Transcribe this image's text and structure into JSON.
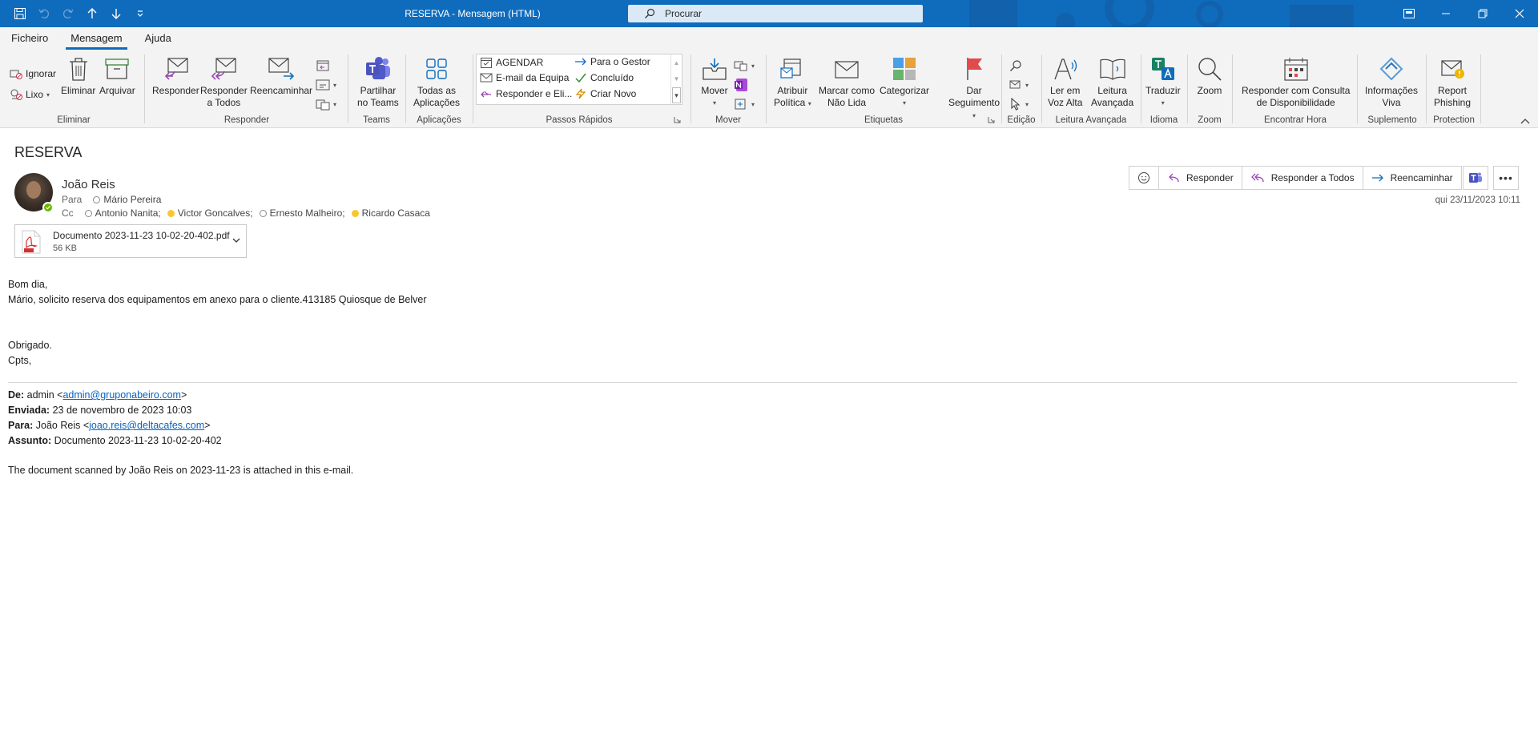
{
  "window": {
    "title": "RESERVA  -  Mensagem (HTML)",
    "search_placeholder": "Procurar",
    "accent": "#0f6cbd"
  },
  "menu": {
    "tabs": [
      "Ficheiro",
      "Mensagem",
      "Ajuda"
    ],
    "active": "Mensagem"
  },
  "ribbon": {
    "eliminar": {
      "label": "Eliminar",
      "ignorar": "Ignorar",
      "lixo": "Lixo",
      "delete": "Eliminar",
      "archive": "Arquivar"
    },
    "responder": {
      "label": "Responder",
      "reply": "Responder",
      "reply_all_1": "Responder",
      "reply_all_2": "a Todos",
      "forward": "Reencaminhar"
    },
    "teams": {
      "label": "Teams",
      "share_1": "Partilhar",
      "share_2": "no Teams"
    },
    "aplicacoes": {
      "label": "Aplicações",
      "all_1": "Todas as",
      "all_2": "Aplicações"
    },
    "passos": {
      "label": "Passos Rápidos",
      "items": [
        "AGENDAR",
        "E-mail da Equipa",
        "Responder e Eli...",
        "Para o Gestor",
        "Concluído",
        "Criar Novo"
      ]
    },
    "mover": {
      "label": "Mover",
      "move": "Mover"
    },
    "etiquetas": {
      "label": "Etiquetas",
      "policy_1": "Atribuir",
      "policy_2": "Política",
      "unread_1": "Marcar como",
      "unread_2": "Não Lida",
      "categorize": "Categorizar",
      "followup_1": "Dar",
      "followup_2": "Seguimento"
    },
    "edicao": {
      "label": "Edição"
    },
    "leitura": {
      "label": "Leitura Avançada",
      "aloud_1": "Ler em",
      "aloud_2": "Voz Alta",
      "immersive_1": "Leitura",
      "immersive_2": "Avançada"
    },
    "idioma": {
      "label": "Idioma",
      "translate": "Traduzir"
    },
    "zoom": {
      "label": "Zoom",
      "zoom": "Zoom"
    },
    "hora": {
      "label": "Encontrar Hora",
      "btn_1": "Responder com Consulta",
      "btn_2": "de Disponibilidade"
    },
    "suplemento": {
      "label": "Suplemento",
      "btn_1": "Informações",
      "btn_2": "Viva"
    },
    "protection": {
      "label": "Protection",
      "btn_1": "Report",
      "btn_2": "Phishing"
    }
  },
  "message": {
    "subject": "RESERVA",
    "sender": "João Reis",
    "to_label": "Para",
    "to": [
      "Mário Pereira"
    ],
    "cc_label": "Cc",
    "cc": [
      "Antonio Nanita;",
      "Victor Goncalves;",
      "Ernesto Malheiro;",
      "Ricardo Casaca"
    ],
    "date": "qui 23/11/2023 10:11",
    "attachment": {
      "name": "Documento 2023-11-23 10-02-20-402.pdf",
      "size": "56 KB"
    },
    "actions": {
      "reply": "Responder",
      "reply_all": "Responder a Todos",
      "forward": "Reencaminhar"
    },
    "body": {
      "greeting": "Bom dia,",
      "line1": "Mário, solicito reserva dos equipamentos em anexo para o cliente.413185 Quiosque de Belver",
      "thanks": "Obrigado.",
      "sign": "Cpts,"
    },
    "forwarded": {
      "from_label": "De:",
      "from_name": "admin <",
      "from_email": "admin@gruponabeiro.com",
      "from_end": ">",
      "sent_label": "Enviada:",
      "sent": "23 de novembro de 2023 10:03",
      "to_label": "Para:",
      "to_name": "João Reis <",
      "to_email": "joao.reis@deltacafes.com",
      "to_end": ">",
      "subject_label": "Assunto:",
      "subject": "Documento 2023-11-23 10-02-20-402",
      "text": "The document scanned by João Reis on 2023-11-23 is attached in this e-mail."
    }
  }
}
